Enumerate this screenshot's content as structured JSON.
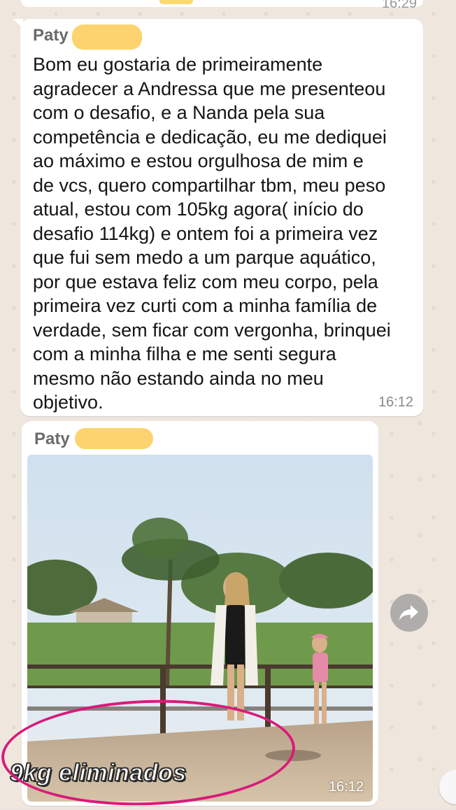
{
  "top_fragment": {
    "time": "16:29"
  },
  "message_text": {
    "sender": "Paty",
    "body": "Bom eu gostaria de primeiramente\nagradecer a Andressa que me presenteou\ncom o desafio, e a Nanda pela sua\ncompetência e dedicação, eu me dediquei\nao máximo e estou orgulhosa de mim e\nde vcs, quero compartilhar tbm, meu peso\natual, estou com 105kg agora( início do\ndesafio 114kg) e ontem foi a primeira vez\nque fui sem medo a um parque aquático,\npor que estava feliz com meu corpo, pela\nprimeira vez curti com a minha família de\nverdade, sem ficar com vergonha, brinquei\ncom a minha filha e me senti segura\nmesmo não estando ainda no meu\nobjetivo.",
    "time": "16:12"
  },
  "message_image": {
    "sender": "Paty",
    "caption": "9kg eliminados",
    "time": "16:12"
  },
  "colors": {
    "chat_background": "#efe7de",
    "bubble": "#ffffff",
    "highlight": "#fcd166",
    "annotation": "#d81b7a"
  },
  "icons": {
    "forward": "forward-arrow-icon"
  }
}
